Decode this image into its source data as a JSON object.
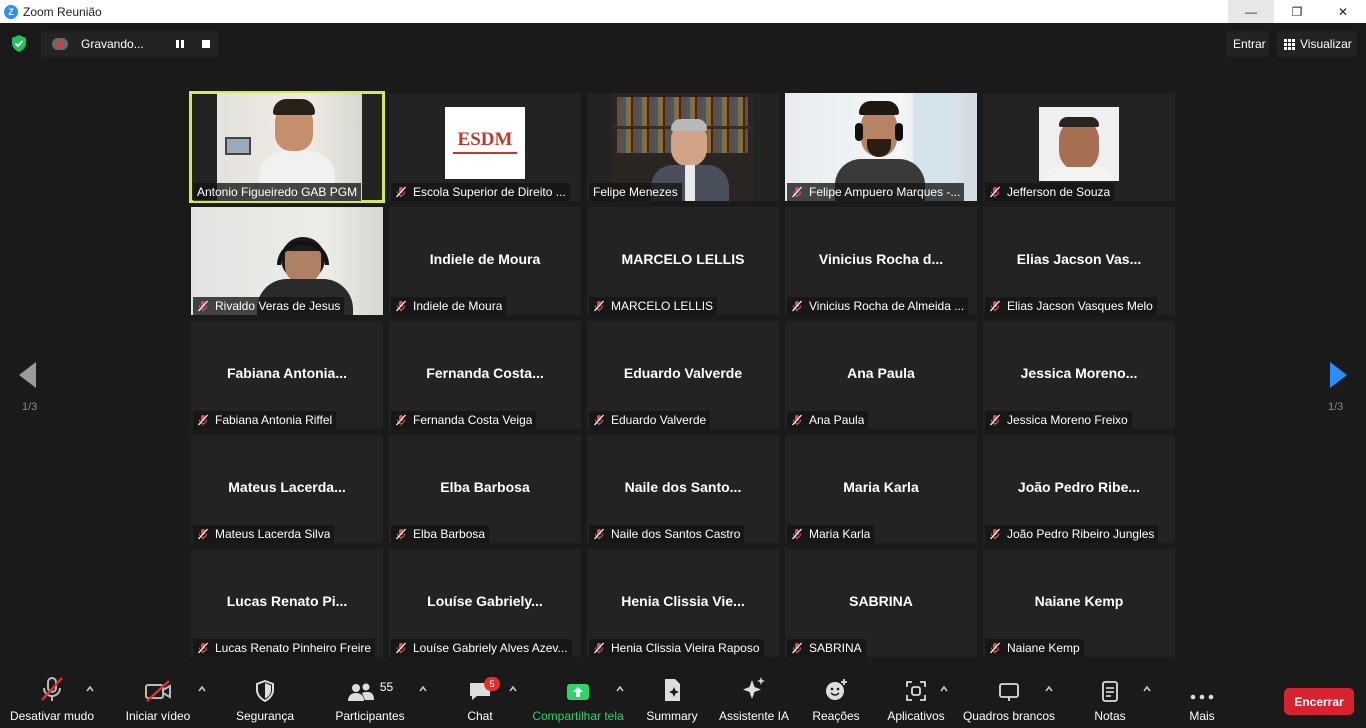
{
  "window": {
    "title": "Zoom Reunião",
    "min": "—",
    "max": "❐",
    "close": "✕"
  },
  "topbar": {
    "recording": "Gravando...",
    "enter": "Entrar",
    "view": "Visualizar"
  },
  "pager": {
    "left": "1/3",
    "right": "1/3"
  },
  "tiles": [
    {
      "name": "Antonio Figueiredo GAB PGM",
      "big": "",
      "active": true,
      "muted": false,
      "video": "person"
    },
    {
      "name": "Escola Superior de Direito ...",
      "big": "",
      "muted": true,
      "video": "logo",
      "logo_text": "ESDM"
    },
    {
      "name": "Felipe Menezes",
      "big": "",
      "muted": false,
      "video": "office"
    },
    {
      "name": "Felipe Ampuero Marques -...",
      "big": "",
      "muted": true,
      "video": "headset"
    },
    {
      "name": "Jefferson de Souza",
      "big": "",
      "muted": true,
      "video": "face"
    },
    {
      "name": "Rivaldo Veras de Jesus",
      "big": "",
      "muted": true,
      "video": "headset2"
    },
    {
      "name": "Indiele de Moura",
      "big": "Indiele de Moura",
      "muted": true
    },
    {
      "name": "MARCELO LELLIS",
      "big": "MARCELO LELLIS",
      "muted": true
    },
    {
      "name": "Vinicius Rocha de Almeida ...",
      "big": "Vinicius Rocha d...",
      "muted": true
    },
    {
      "name": "Elias Jacson Vasques Melo",
      "big": "Elias Jacson Vas...",
      "muted": true
    },
    {
      "name": "Fabiana Antonia Riffel",
      "big": "Fabiana Antonia...",
      "muted": true
    },
    {
      "name": "Fernanda Costa Veiga",
      "big": "Fernanda Costa...",
      "muted": true
    },
    {
      "name": "Eduardo Valverde",
      "big": "Eduardo Valverde",
      "muted": true
    },
    {
      "name": "Ana Paula",
      "big": "Ana Paula",
      "muted": true
    },
    {
      "name": "Jessica Moreno Freixo",
      "big": "Jessica Moreno...",
      "muted": true
    },
    {
      "name": "Mateus Lacerda Silva",
      "big": "Mateus Lacerda...",
      "muted": true
    },
    {
      "name": "Elba Barbosa",
      "big": "Elba Barbosa",
      "muted": true
    },
    {
      "name": "Naile dos Santos Castro",
      "big": "Naile dos Santo...",
      "muted": true
    },
    {
      "name": "Maria Karla",
      "big": "Maria Karla",
      "muted": true
    },
    {
      "name": "João Pedro Ribeiro Jungles",
      "big": "João Pedro Ribe...",
      "muted": true
    },
    {
      "name": "Lucas Renato Pinheiro Freire",
      "big": "Lucas Renato Pi...",
      "muted": true
    },
    {
      "name": "Louíse Gabriely Alves Azev...",
      "big": "Louíse Gabriely...",
      "muted": true
    },
    {
      "name": "Henia Clissia Vieira Raposo",
      "big": "Henia Clissia Vie...",
      "muted": true
    },
    {
      "name": "SABRINA",
      "big": "SABRINA",
      "muted": true
    },
    {
      "name": "Naiane Kemp",
      "big": "Naiane Kemp",
      "muted": true
    }
  ],
  "toolbar": {
    "mute": "Desativar mudo",
    "video": "Iniciar vídeo",
    "security": "Segurança",
    "participants": "Participantes",
    "participants_count": "55",
    "chat": "Chat",
    "chat_badge": "5",
    "share": "Compartilhar tela",
    "summary": "Summary",
    "assistant": "Assistente IA",
    "reactions": "Reações",
    "apps": "Aplicativos",
    "whiteboards": "Quadros brancos",
    "notes": "Notas",
    "more": "Mais",
    "end": "Encerrar"
  },
  "colors": {
    "active_border": "#d4e85a",
    "share_green": "#2ed46c",
    "end_red": "#d6232f",
    "nav_blue": "#2d8cff"
  }
}
